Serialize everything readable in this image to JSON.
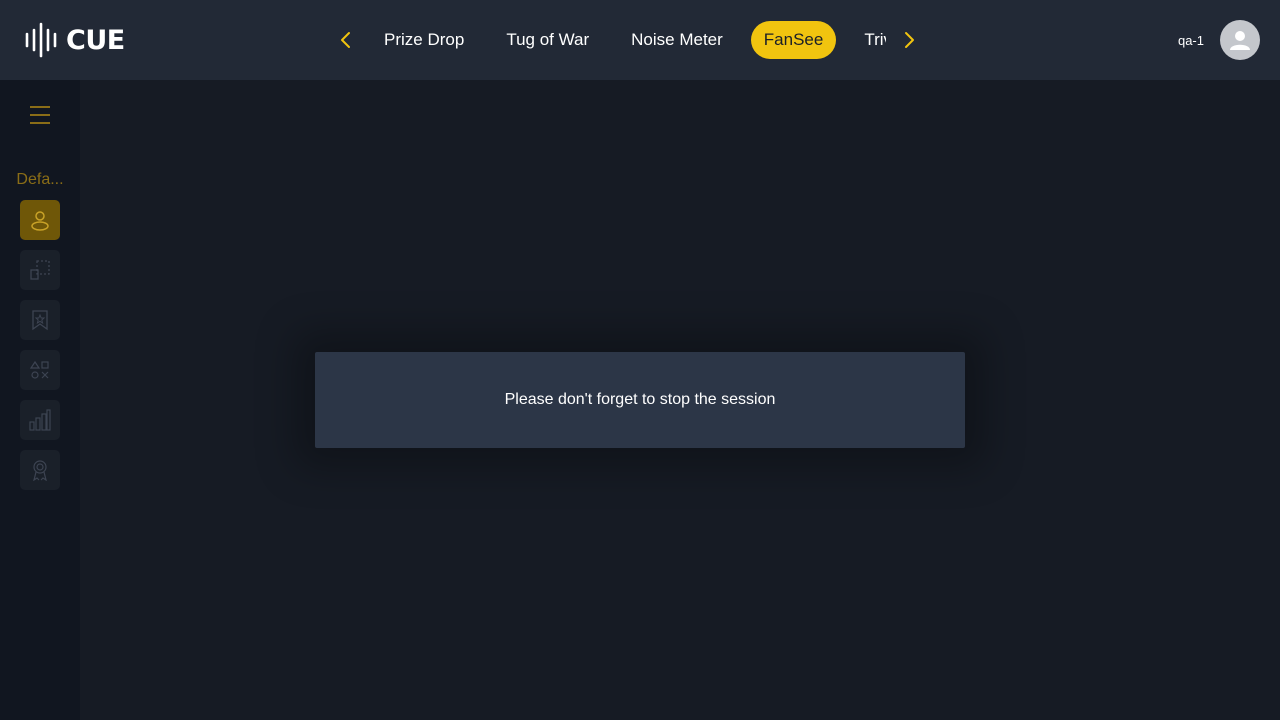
{
  "header": {
    "logo_text": "CUE",
    "tabs": [
      {
        "label": "Prize Drop"
      },
      {
        "label": "Tug of War"
      },
      {
        "label": "Noise Meter"
      },
      {
        "label": "FanSee",
        "active": true
      },
      {
        "label": "Trivia"
      }
    ],
    "username": "qa-1",
    "prev_icon": "chevron-left-icon",
    "next_icon": "chevron-right-icon",
    "avatar_icon": "user-avatar-icon"
  },
  "sidebar": {
    "menu_icon": "hamburger-menu-icon",
    "group_label": "Defa...",
    "items": [
      {
        "icon": "user-icon",
        "active": true
      },
      {
        "icon": "layout-select-icon"
      },
      {
        "icon": "bookmark-star-icon"
      },
      {
        "icon": "shapes-icon"
      },
      {
        "icon": "bar-chart-icon"
      },
      {
        "icon": "award-ribbon-icon"
      }
    ]
  },
  "modal": {
    "message": "Please don't forget to stop the session"
  },
  "colors": {
    "accent": "#f1c40f",
    "header_bg": "#222936",
    "page_bg": "#161b24",
    "sidebar_bg": "#111620",
    "modal_bg": "#2c3647"
  }
}
